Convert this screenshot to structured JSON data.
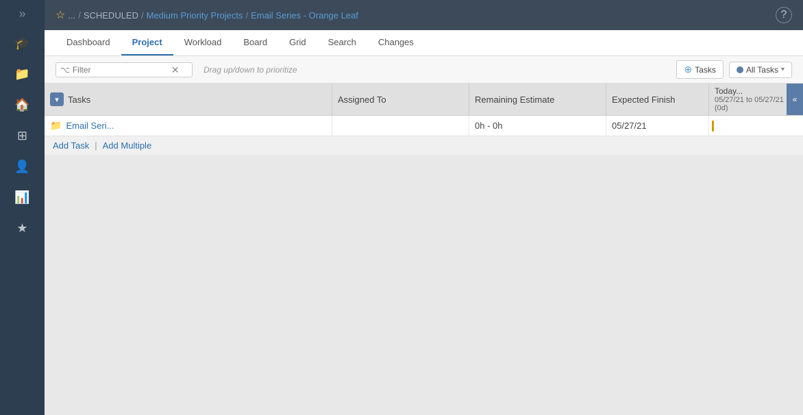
{
  "sidebar": {
    "expand_icon": "»",
    "items": [
      {
        "id": "graduation",
        "icon": "🎓",
        "label": "Learning",
        "active": false
      },
      {
        "id": "folder",
        "icon": "📁",
        "label": "Folder",
        "active": false
      },
      {
        "id": "home",
        "icon": "🏠",
        "label": "Home",
        "active": false
      },
      {
        "id": "grid",
        "icon": "⊞",
        "label": "Grid",
        "active": false
      },
      {
        "id": "user-clock",
        "icon": "👤",
        "label": "User Clock",
        "active": false
      },
      {
        "id": "chart",
        "icon": "📊",
        "label": "Chart",
        "active": false
      },
      {
        "id": "star",
        "icon": "★",
        "label": "Favorites",
        "active": false
      }
    ]
  },
  "header": {
    "star_icon": "☆",
    "breadcrumb": {
      "ellipsis": "...",
      "sep1": "/",
      "scheduled": "SCHEDULED",
      "sep2": "/",
      "medium_priority": "Medium Priority Projects",
      "sep3": "/",
      "email_series": "Email Series - Orange Leaf"
    },
    "help_icon": "?"
  },
  "tabs": {
    "items": [
      {
        "id": "dashboard",
        "label": "Dashboard",
        "active": false
      },
      {
        "id": "project",
        "label": "Project",
        "active": true
      },
      {
        "id": "workload",
        "label": "Workload",
        "active": false
      },
      {
        "id": "board",
        "label": "Board",
        "active": false
      },
      {
        "id": "grid",
        "label": "Grid",
        "active": false
      },
      {
        "id": "search",
        "label": "Search",
        "active": false
      },
      {
        "id": "changes",
        "label": "Changes",
        "active": false
      }
    ]
  },
  "toolbar": {
    "filter_placeholder": "Filter",
    "filter_clear_icon": "✕",
    "drag_hint": "Drag up/down to prioritize",
    "tasks_btn_label": "Tasks",
    "tasks_btn_icon": "⊕",
    "all_tasks_label": "All Tasks",
    "dropdown_arrow": "▾"
  },
  "grid": {
    "columns": {
      "tasks_label": "Tasks",
      "assigned_label": "Assigned To",
      "remaining_label": "Remaining Estimate",
      "expected_label": "Expected Finish",
      "today_label": "Today...",
      "date_range": "05/27/21 to 05/27/21 (0d)"
    },
    "collapse_icon": "▾",
    "gantt_collapse_icon": "«",
    "rows": [
      {
        "id": "email-series-row",
        "folder_icon": "📁",
        "task_name": "Email Seri...",
        "assigned": "",
        "remaining": "0h - 0h",
        "expected_finish": "05/27/21",
        "has_gantt_bar": true
      }
    ],
    "add_task_label": "Add Task",
    "add_multiple_label": "Add Multiple",
    "separator": "|"
  }
}
